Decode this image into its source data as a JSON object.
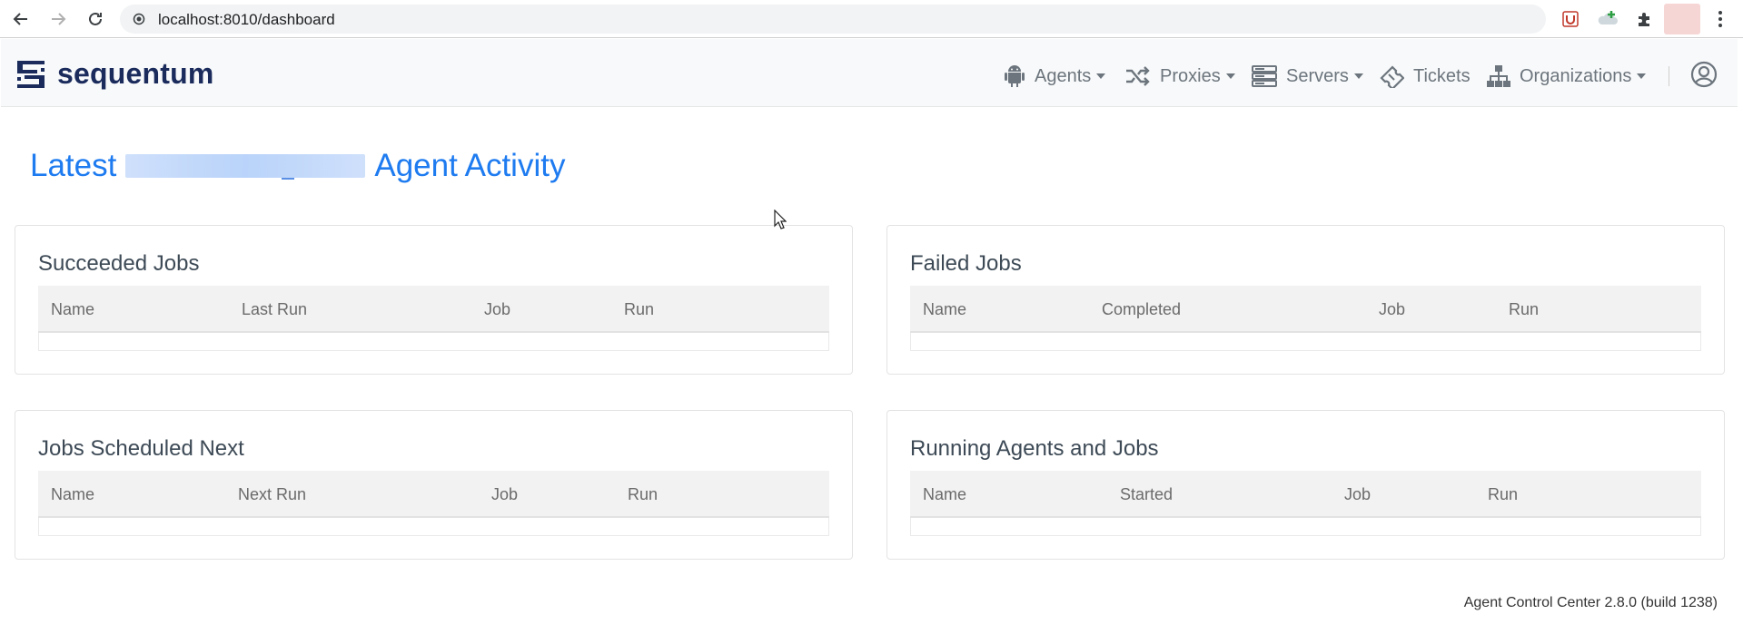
{
  "browser": {
    "url": "localhost:8010/dashboard"
  },
  "header": {
    "brand": "sequentum",
    "nav": [
      {
        "label": "Agents",
        "icon": "android-icon",
        "dropdown": true
      },
      {
        "label": "Proxies",
        "icon": "shuffle-icon",
        "dropdown": true
      },
      {
        "label": "Servers",
        "icon": "server-icon",
        "dropdown": true
      },
      {
        "label": "Tickets",
        "icon": "ticket-icon",
        "dropdown": false
      },
      {
        "label": "Organizations",
        "icon": "sitemap-icon",
        "dropdown": true
      }
    ]
  },
  "page": {
    "title_prefix": "Latest",
    "title_suffix": "Agent Activity"
  },
  "panels": {
    "succeeded": {
      "title": "Succeeded Jobs",
      "columns": [
        "Name",
        "Last Run",
        "Job",
        "Run"
      ]
    },
    "failed": {
      "title": "Failed Jobs",
      "columns": [
        "Name",
        "Completed",
        "Job",
        "Run"
      ]
    },
    "scheduled": {
      "title": "Jobs Scheduled Next",
      "columns": [
        "Name",
        "Next Run",
        "Job",
        "Run"
      ]
    },
    "running": {
      "title": "Running Agents and Jobs",
      "columns": [
        "Name",
        "Started",
        "Job",
        "Run"
      ]
    }
  },
  "footer": {
    "version": "Agent Control Center 2.8.0 (build 1238)"
  },
  "colors": {
    "accent": "#1e7bf0",
    "brand": "#1a2b5c",
    "nav_text": "#6c757d"
  }
}
